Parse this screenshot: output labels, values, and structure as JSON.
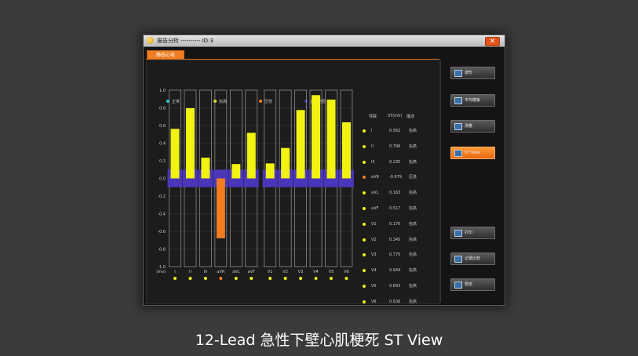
{
  "window": {
    "title": "报告分析 ---------- ID:3",
    "close_glyph": "✕",
    "tab_label": "静态心电"
  },
  "legend": [
    {
      "label": "正常",
      "color": "#29d6d6"
    },
    {
      "label": "抬高",
      "color": "#f2f213"
    },
    {
      "label": "压低",
      "color": "#f07d22"
    },
    {
      "label": "正常范围",
      "color": "#4a36b8"
    }
  ],
  "table": {
    "headers": {
      "lead": "导联",
      "st": "ST(mV)",
      "desc": "描述"
    },
    "rows": [
      {
        "lead": "I",
        "st": "0.562",
        "desc": "抬高",
        "color": "#f2f213"
      },
      {
        "lead": "II",
        "st": "0.796",
        "desc": "抬高",
        "color": "#f2f213"
      },
      {
        "lead": "III",
        "st": "0.235",
        "desc": "抬高",
        "color": "#f2f213"
      },
      {
        "lead": "aVR",
        "st": "-0.679",
        "desc": "压低",
        "color": "#f07d22"
      },
      {
        "lead": "aVL",
        "st": "0.163",
        "desc": "抬高",
        "color": "#f2f213"
      },
      {
        "lead": "aVF",
        "st": "0.517",
        "desc": "抬高",
        "color": "#f2f213"
      },
      {
        "lead": "V1",
        "st": "0.170",
        "desc": "抬高",
        "color": "#f2f213"
      },
      {
        "lead": "V2",
        "st": "0.345",
        "desc": "抬高",
        "color": "#f2f213"
      },
      {
        "lead": "V3",
        "st": "0.775",
        "desc": "抬高",
        "color": "#f2f213"
      },
      {
        "lead": "V4",
        "st": "0.944",
        "desc": "抬高",
        "color": "#f2f213"
      },
      {
        "lead": "V5",
        "st": "0.893",
        "desc": "抬高",
        "color": "#f2f213"
      },
      {
        "lead": "V6",
        "st": "0.636",
        "desc": "抬高",
        "color": "#f2f213"
      }
    ]
  },
  "sidebar": {
    "buttons": [
      {
        "label": "波形",
        "active": false
      },
      {
        "label": "平均模板",
        "active": false
      },
      {
        "label": "测量",
        "active": false
      },
      {
        "label": "ST View",
        "active": true
      },
      {
        "label": "打印",
        "active": false
      },
      {
        "label": "记录比较",
        "active": false
      },
      {
        "label": "预览",
        "active": false
      }
    ]
  },
  "chart_data": {
    "type": "bar",
    "categories": [
      "I",
      "II",
      "III",
      "aVR",
      "aVL",
      "aVF",
      "V1",
      "V2",
      "V3",
      "V4",
      "V5",
      "V6"
    ],
    "values": [
      0.562,
      0.796,
      0.235,
      -0.679,
      0.163,
      0.517,
      0.17,
      0.345,
      0.775,
      0.944,
      0.893,
      0.636
    ],
    "colors": [
      "#f2f213",
      "#f2f213",
      "#f2f213",
      "#f07d22",
      "#f2f213",
      "#f2f213",
      "#f2f213",
      "#f2f213",
      "#f2f213",
      "#f2f213",
      "#f2f213",
      "#f2f213"
    ],
    "normal_range": [
      -0.1,
      0.1
    ],
    "normal_range_color": "#4a36b8",
    "ylim": [
      -1.0,
      1.0
    ],
    "yticks": [
      "1.0",
      "0.8",
      "0.6",
      "0.4",
      "0.2",
      "0.0",
      "-0.2",
      "-0.4",
      "-0.6",
      "-0.8",
      "-1.0"
    ],
    "ylabel": "(mv)",
    "grid": true
  },
  "caption": "12-Lead 急性下壁心肌梗死 ST View"
}
